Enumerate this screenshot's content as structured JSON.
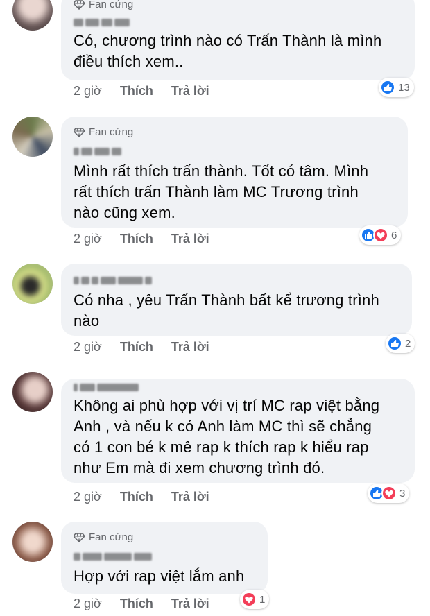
{
  "badge_label": "Fan cứng",
  "actions": {
    "time": "2 giờ",
    "like": "Thích",
    "reply": "Trả lời"
  },
  "colors": {
    "like": "#1877f2",
    "love": "#f33e58",
    "bubble": "#f0f2f5",
    "meta": "#65676b"
  },
  "comments": [
    {
      "has_badge": true,
      "text": "Có, chương trình nào có Trấn Thành là mình\nđiều thích xem..",
      "reactions": [
        "like"
      ],
      "reaction_count": "13"
    },
    {
      "has_badge": true,
      "text": "Mình rất thích trấn thành. Tốt có tâm. Mình\nrất thích trấn Thành làm MC Trương trình\nnào cũng xem.",
      "reactions": [
        "like",
        "love"
      ],
      "reaction_count": "6"
    },
    {
      "has_badge": false,
      "text": "Có nha , yêu Trấn Thành bất kể trương trình\nnào",
      "reactions": [
        "like"
      ],
      "reaction_count": "2"
    },
    {
      "has_badge": false,
      "text": "Không ai phù hợp với vị trí MC rap việt bằng\nAnh  , và nếu k có Anh làm MC thì sẽ chẳng\ncó 1 con bé k mê rap k thích rap k hiểu rap\nnhư Em mà đi xem chương trình đó.",
      "reactions": [
        "like",
        "love"
      ],
      "reaction_count": "3"
    },
    {
      "has_badge": true,
      "text": "Hợp với rap việt lắm anh",
      "reactions": [
        "love"
      ],
      "reaction_count": "1"
    }
  ]
}
